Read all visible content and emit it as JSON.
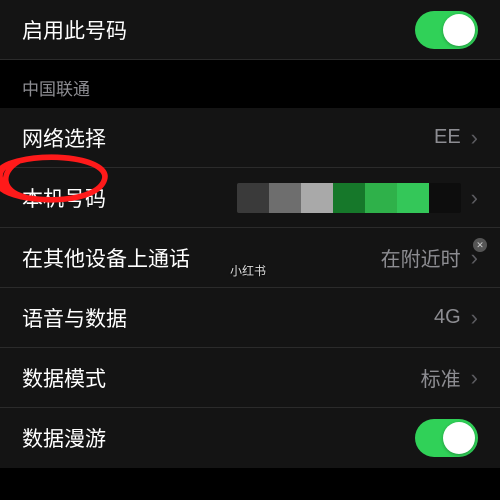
{
  "top": {
    "enable_label": "启用此号码",
    "enable_on": true
  },
  "carrier_header": "中国联通",
  "rows": {
    "network": {
      "label": "网络选择",
      "value": "EE"
    },
    "mynumber": {
      "label": "本机号码"
    },
    "othercalls": {
      "label": "在其他设备上通话",
      "value": "在附近时"
    },
    "voicedata": {
      "label": "语音与数据",
      "value": "4G"
    },
    "datamode": {
      "label": "数据模式",
      "value": "标准"
    },
    "roaming": {
      "label": "数据漫游",
      "on": true
    }
  },
  "watermark": "小红书",
  "mask_colors": [
    "#3a3a3a",
    "#6e6e6e",
    "#a9a9a9",
    "#16782a",
    "#2fb14a",
    "#34c759",
    "#0d0d0d"
  ]
}
